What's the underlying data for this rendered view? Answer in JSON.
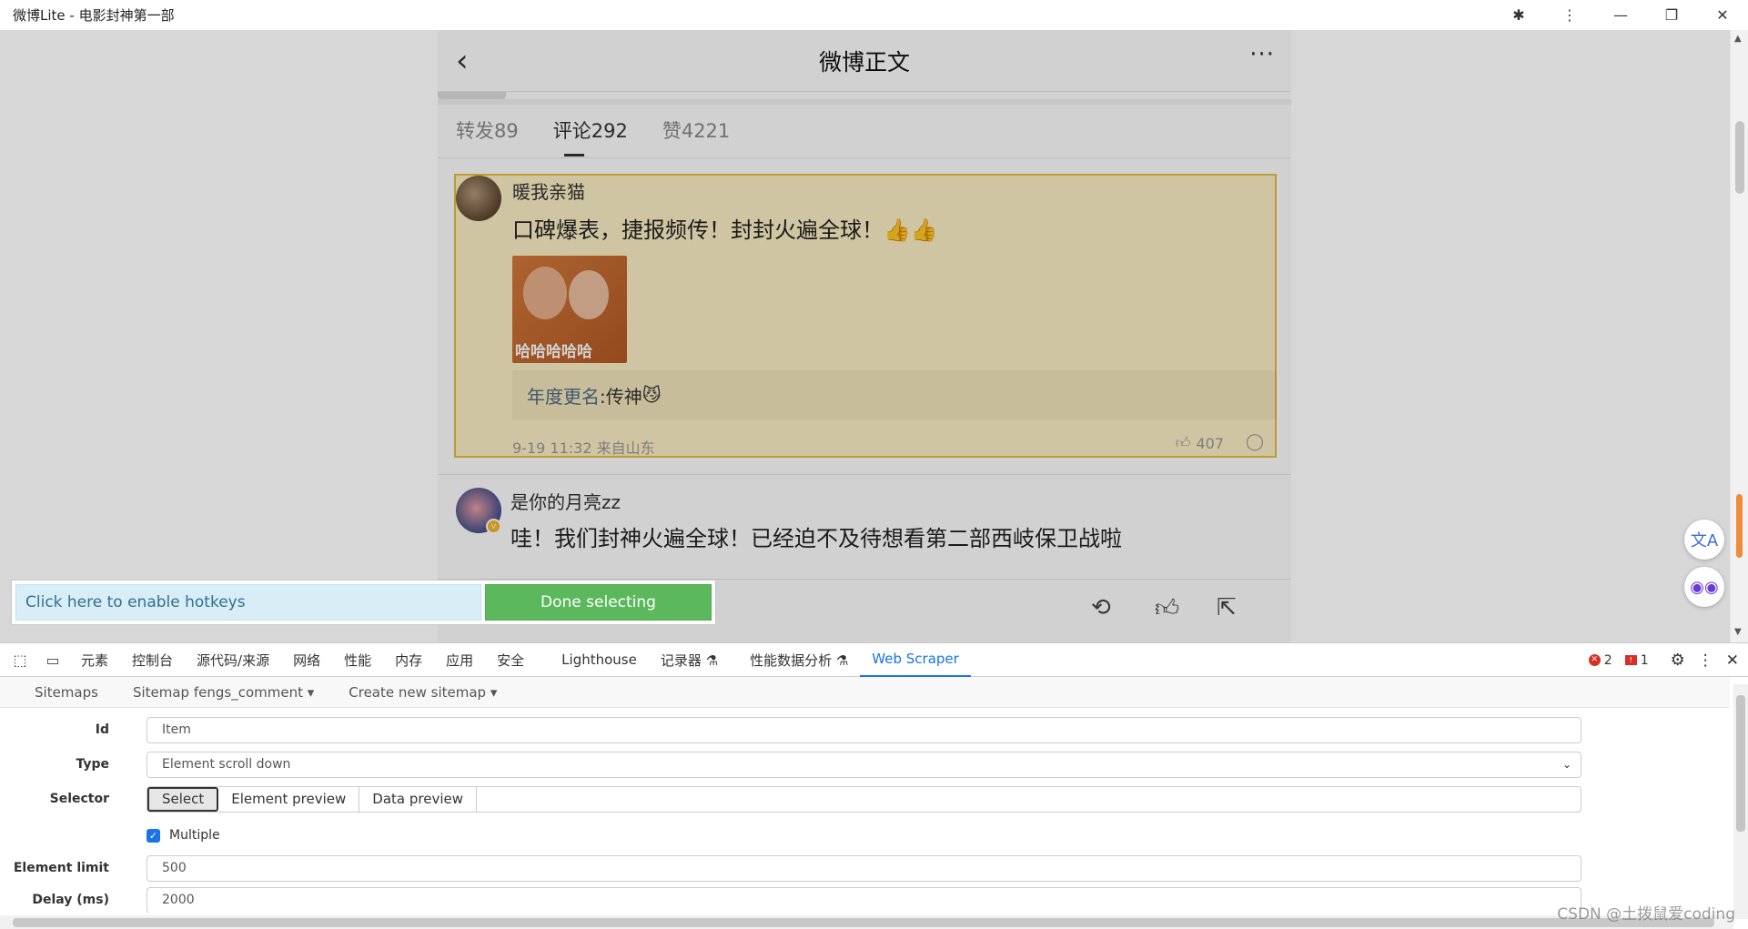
{
  "window": {
    "title": "微博Lite - 电影封神第一部",
    "buttons": [
      "extensions-icon",
      "menu-icon",
      "minimize-icon",
      "restore-icon",
      "close-icon"
    ]
  },
  "weibo": {
    "header": {
      "back_icon": "‹",
      "title": "微博正文",
      "more_icon": "···"
    },
    "tabs": [
      {
        "label": "转发89",
        "active": false
      },
      {
        "label": "评论292",
        "active": true
      },
      {
        "label": "赞4221",
        "active": false
      }
    ],
    "comments": [
      {
        "user": "暖我亲猫",
        "text": "口碑爆表，捷报频传！封封火遍全球！",
        "emoji": "👍👍",
        "image_caption": "哈哈哈哈哈",
        "reply_name": "年度更名",
        "reply_text": ":传神",
        "reply_emoji": "😼",
        "meta": "9-19 11:32 来自山东",
        "likes": "407"
      },
      {
        "user": "是你的月亮zz",
        "verified_badge": "v",
        "text": "哇！我们封神火遍全球！已经迫不及待想看第二部西岐保卫战啦"
      }
    ],
    "bottom_bar": [
      "repost-icon",
      "like-icon",
      "share-icon"
    ]
  },
  "scraper_overlay": {
    "hotkeys_label": "Click here to enable hotkeys",
    "done_label": "Done selecting"
  },
  "side_buttons": {
    "translate_icon": "文A",
    "assistant_icon": "◉◉"
  },
  "devtools": {
    "tabs": [
      {
        "label": "元素",
        "active": false
      },
      {
        "label": "控制台",
        "active": false
      },
      {
        "label": "源代码/来源",
        "active": false
      },
      {
        "label": "网络",
        "active": false
      },
      {
        "label": "性能",
        "active": false
      },
      {
        "label": "内存",
        "active": false
      },
      {
        "label": "应用",
        "active": false
      },
      {
        "label": "安全",
        "active": false
      },
      {
        "label": "Lighthouse",
        "active": false
      },
      {
        "label": "记录器 ⚗",
        "active": false
      },
      {
        "label": "性能数据分析 ⚗",
        "active": false
      },
      {
        "label": "Web Scraper",
        "active": true
      }
    ],
    "error_count": "2",
    "issue_count": "1"
  },
  "webscraper": {
    "nav": [
      "Sitemaps",
      "Sitemap fengs_comment ▾",
      "Create new sitemap ▾"
    ],
    "form": {
      "id_label": "Id",
      "id_value": "Item",
      "type_label": "Type",
      "type_value": "Element scroll down",
      "selector_label": "Selector",
      "selector_buttons": [
        "Select",
        "Element preview",
        "Data preview"
      ],
      "selector_value": "",
      "multiple_label": "Multiple",
      "multiple_checked": true,
      "limit_label": "Element limit",
      "limit_value": "500",
      "delay_label": "Delay (ms)",
      "delay_value": "2000"
    }
  },
  "watermark": "CSDN @土拨鼠爱coding"
}
